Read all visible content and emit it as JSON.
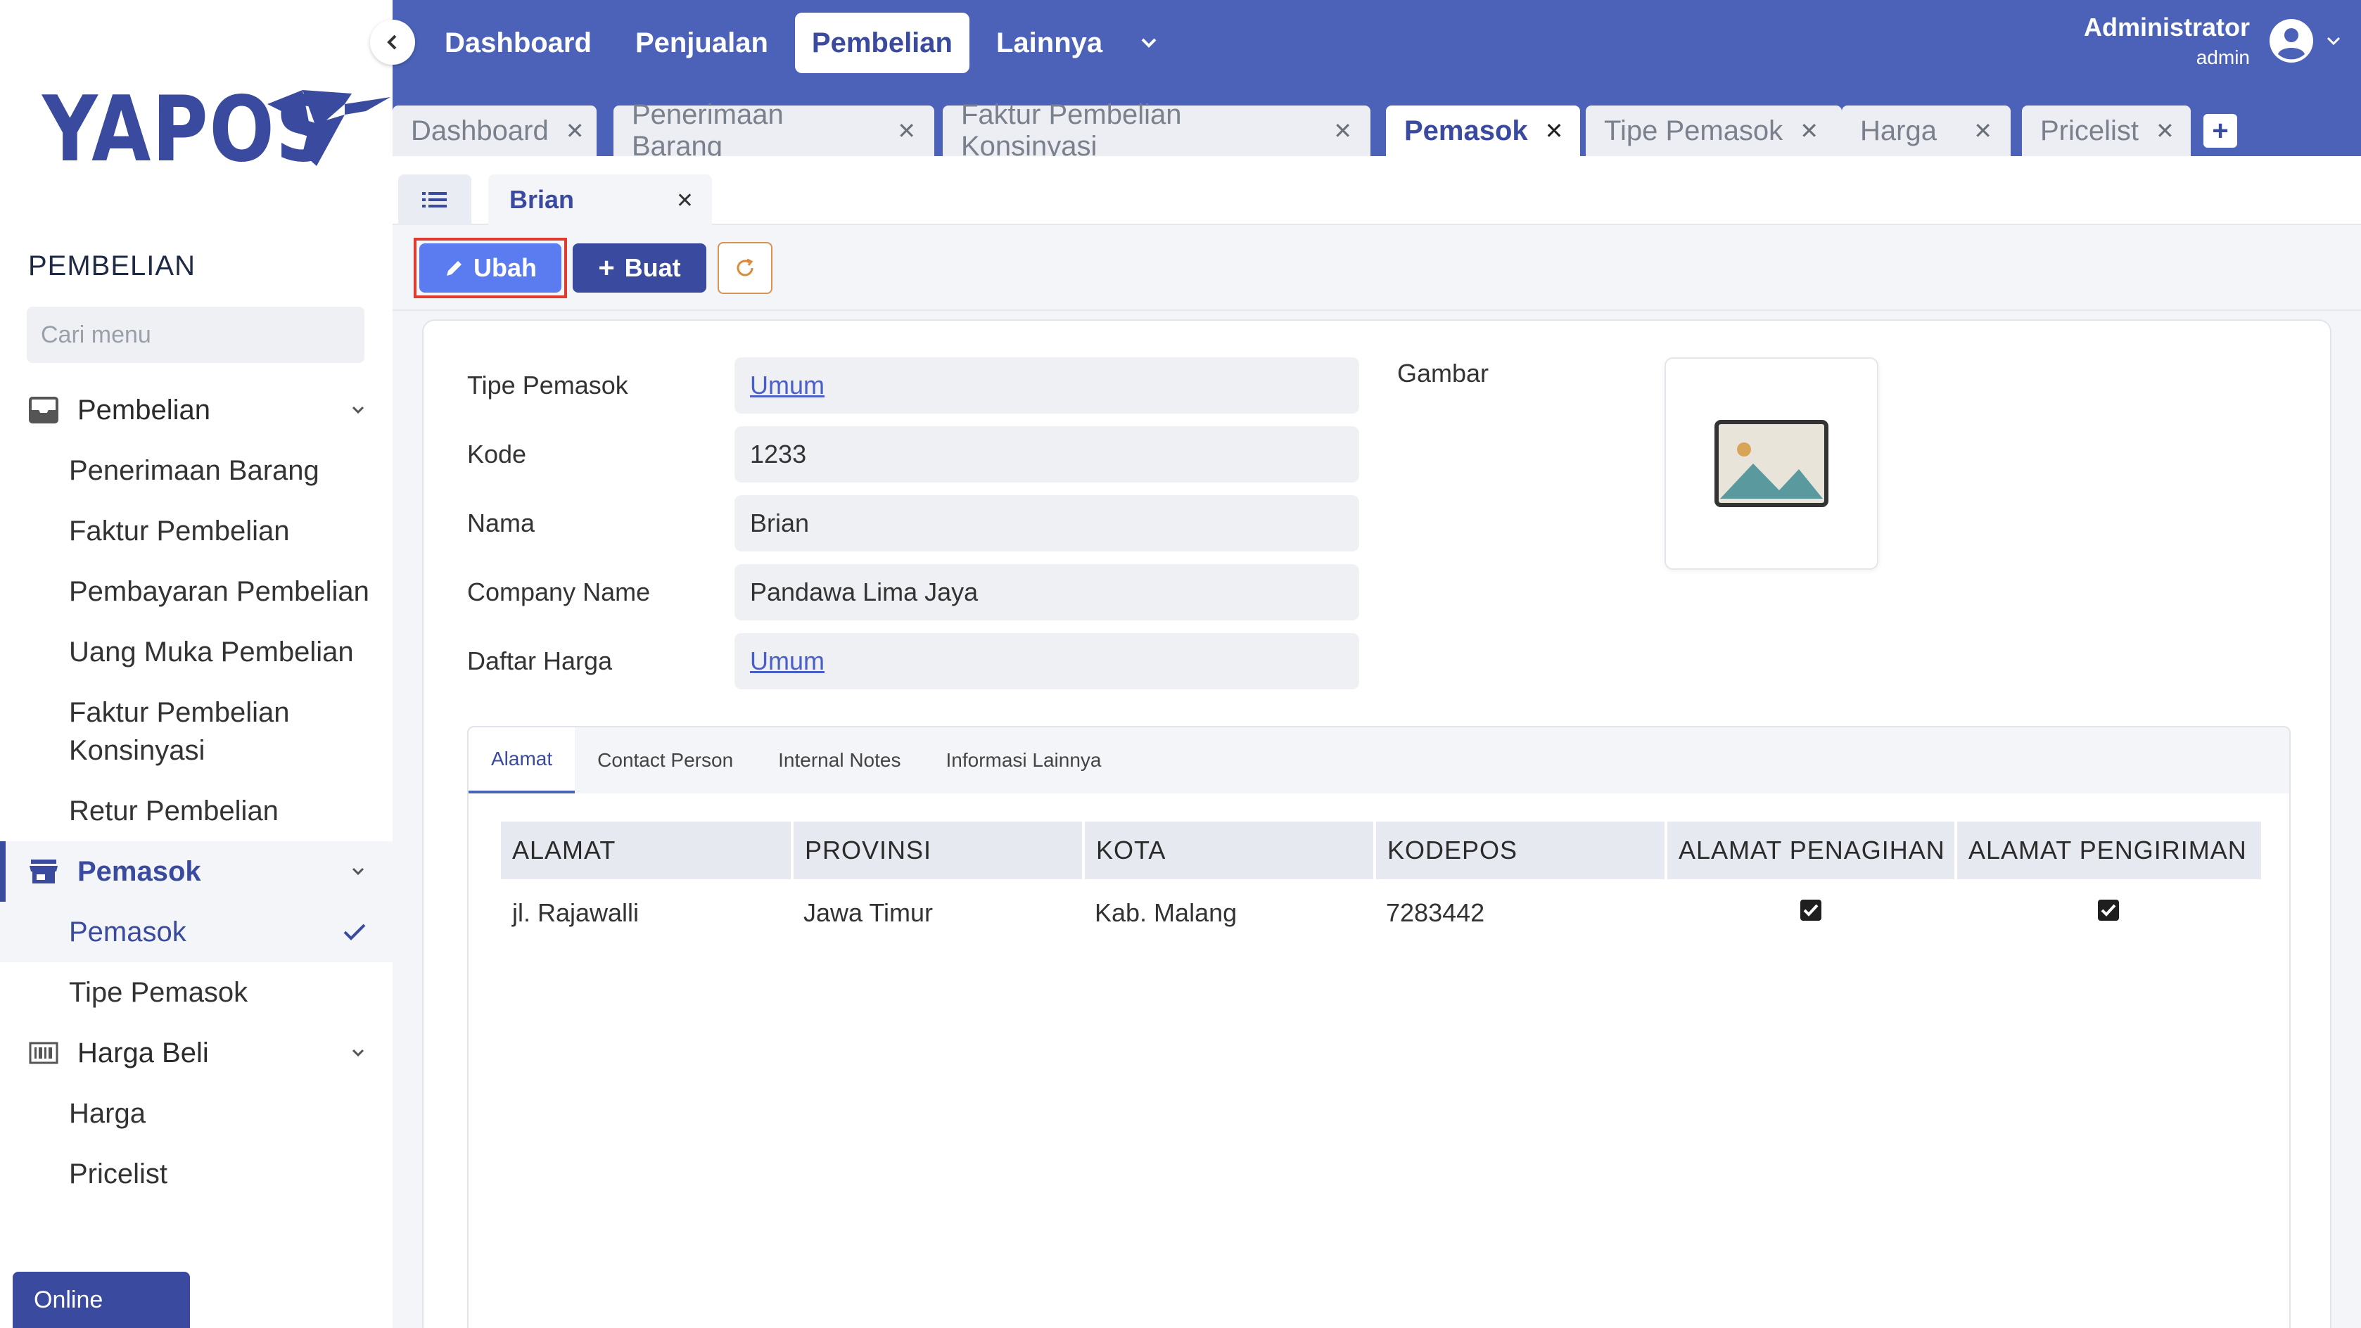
{
  "sidebar": {
    "logo": "YAPOS",
    "heading": "PEMBELIAN",
    "search_placeholder": "Cari menu",
    "groups": [
      {
        "label": "Pembelian",
        "items": [
          "Penerimaan Barang",
          "Faktur Pembelian",
          "Pembayaran Pembelian",
          "Uang Muka Pembelian",
          "Faktur Pembelian Konsinyasi",
          "Retur Pembelian"
        ]
      },
      {
        "label": "Pemasok",
        "items": [
          "Pemasok",
          "Tipe Pemasok"
        ]
      },
      {
        "label": "Harga Beli",
        "items": [
          "Harga",
          "Pricelist"
        ]
      }
    ],
    "status": "Online"
  },
  "topbar": {
    "nav": [
      "Dashboard",
      "Penjualan",
      "Pembelian",
      "Lainnya"
    ],
    "active_nav": "Pembelian",
    "user_name": "Administrator",
    "user_role": "admin"
  },
  "tabs": [
    "Dashboard",
    "Penerimaan Barang",
    "Faktur Pembelian Konsinyasi",
    "Pemasok",
    "Tipe Pemasok",
    "Harga",
    "Pricelist"
  ],
  "active_tab": "Pemasok",
  "doc_tab": "Brian",
  "toolbar": {
    "edit_label": "Ubah",
    "new_label": "Buat"
  },
  "form": {
    "fields": [
      {
        "label": "Tipe Pemasok",
        "value": "Umum"
      },
      {
        "label": "Kode",
        "value": "1233"
      },
      {
        "label": "Nama",
        "value": "Brian"
      },
      {
        "label": "Company Name",
        "value": "Pandawa Lima Jaya"
      },
      {
        "label": "Daftar Harga",
        "value": "Umum"
      }
    ],
    "image_label": "Gambar"
  },
  "detail_tabs": [
    "Alamat",
    "Contact Person",
    "Internal Notes",
    "Informasi Lainnya"
  ],
  "address_table": {
    "headers": [
      "ALAMAT",
      "PROVINSI",
      "KOTA",
      "KODEPOS",
      "ALAMAT PENAGIHAN",
      "ALAMAT PENGIRIMAN"
    ],
    "rows": [
      {
        "alamat": "jl. Rajawalli",
        "provinsi": "Jawa Timur",
        "kota": "Kab. Malang",
        "kodepos": "7283442",
        "penagihan": true,
        "pengiriman": true
      }
    ]
  },
  "colors": {
    "primary": "#4b62b8",
    "accent": "#3a4a9e",
    "edit_button": "#5b7cf0",
    "highlight": "#e03b2e"
  }
}
